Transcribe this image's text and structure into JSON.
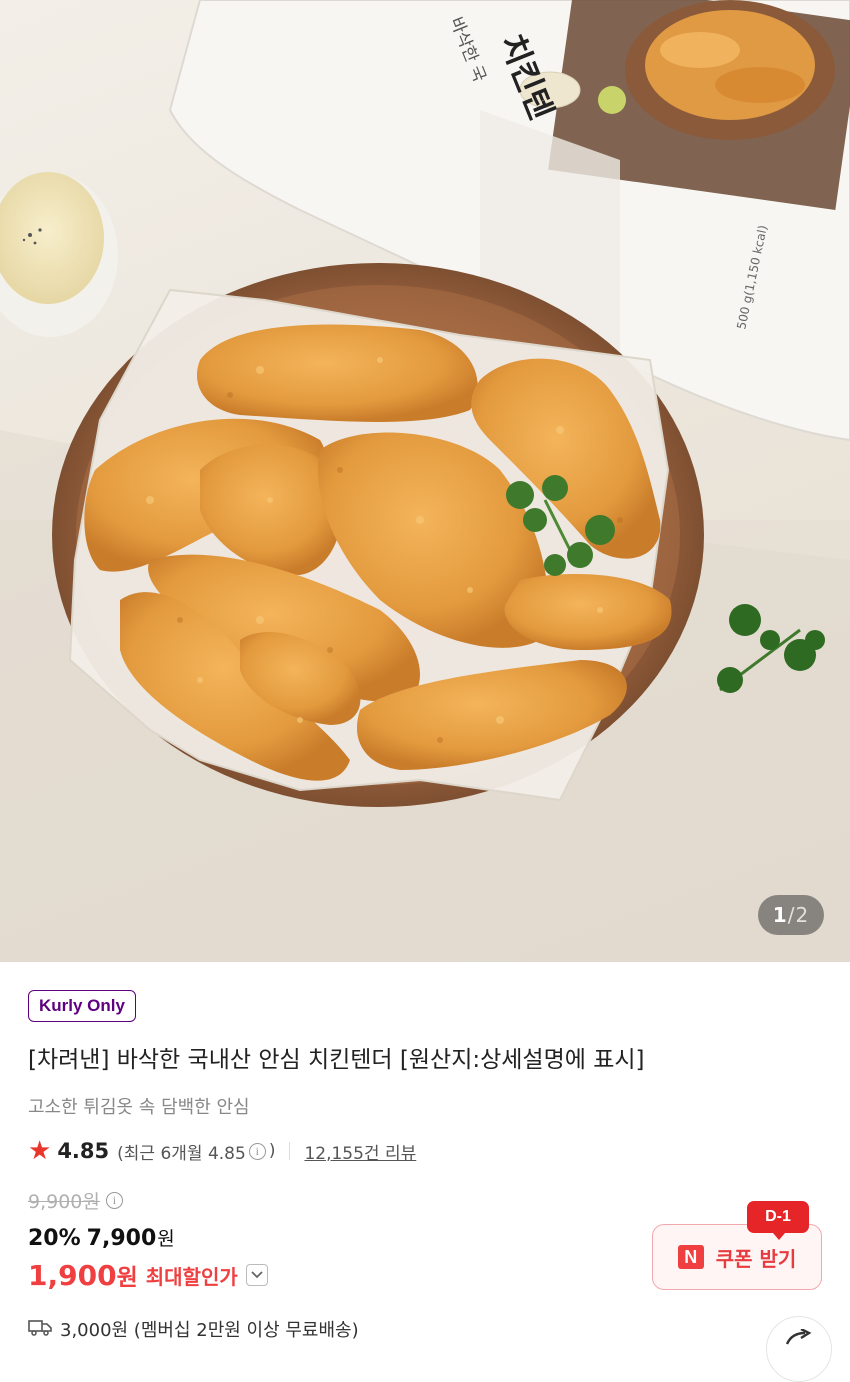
{
  "gallery": {
    "current": "1",
    "separator": "/",
    "total": "2"
  },
  "product": {
    "badge": "Kurly Only",
    "title": "[차려낸] 바삭한 국내산 안심 치킨텐더 [원산지:상세설명에 표시]",
    "subtitle": "고소한 튀김옷 속 담백한 안심",
    "rating": "4.85",
    "recent_rating_prefix": "(최근 6개월 4.85",
    "recent_rating_suffix": ")",
    "review_count": "12,155건 리뷰"
  },
  "price": {
    "original": "9,900원",
    "discount_rate": "20%",
    "sale_price": "7,900",
    "sale_unit": "원",
    "max_price": "1,900",
    "max_unit": "원",
    "max_label": "최대할인가"
  },
  "coupon": {
    "dday": "D-1",
    "logo": "N",
    "label": "쿠폰 받기"
  },
  "delivery": {
    "text": "3,000원 (멤버십 2만원 이상 무료배송)"
  },
  "image_text": {
    "package_title": "치킨텐",
    "package_subtitle": "바삭한 국",
    "package_weight": "500 g(1,150 kcal)"
  },
  "colors": {
    "brand_purple": "#5f0080",
    "accent_red": "#f03f40",
    "star": "#e8362b"
  },
  "icons": [
    "star-icon",
    "info-icon",
    "chevron-down-icon",
    "naver-n-icon",
    "truck-icon",
    "share-icon"
  ]
}
